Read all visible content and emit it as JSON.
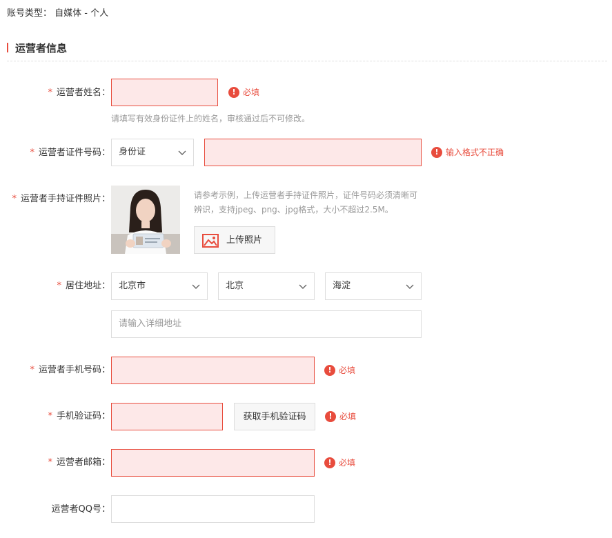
{
  "account": {
    "label": "账号类型：",
    "value": "自媒体 - 个人"
  },
  "section": {
    "title": "运营者信息"
  },
  "fields": {
    "name": {
      "required": "*",
      "label": "运营者姓名：",
      "error": "必填",
      "hint": "请填写有效身份证件上的姓名，审核通过后不可修改。"
    },
    "id_number": {
      "required": "*",
      "label": "运营者证件号码：",
      "type_selected": "身份证",
      "error": "输入格式不正确"
    },
    "id_photo": {
      "required": "*",
      "label": "运营者手持证件照片：",
      "hint": "请参考示例，上传运营者手持证件照片，证件号码必须清晰可辨识，支持jpeg、png、jpg格式，大小不超过2.5M。",
      "upload_label": "上传照片"
    },
    "address": {
      "required": "*",
      "label": "居住地址：",
      "province": "北京市",
      "city": "北京",
      "district": "海淀",
      "detail_placeholder": "请输入详细地址"
    },
    "phone": {
      "required": "*",
      "label": "运营者手机号码：",
      "error": "必填"
    },
    "sms_code": {
      "required": "*",
      "label": "手机验证码：",
      "button": "获取手机验证码",
      "error": "必填"
    },
    "email": {
      "required": "*",
      "label": "运营者邮箱：",
      "error": "必填"
    },
    "qq": {
      "label": "运营者QQ号："
    }
  },
  "icons": {
    "error": "exclamation-circle-icon",
    "dropdown": "chevron-down-icon",
    "upload": "image-icon"
  },
  "colors": {
    "accent": "#e84c3d",
    "error_bg": "#fde8e8"
  }
}
